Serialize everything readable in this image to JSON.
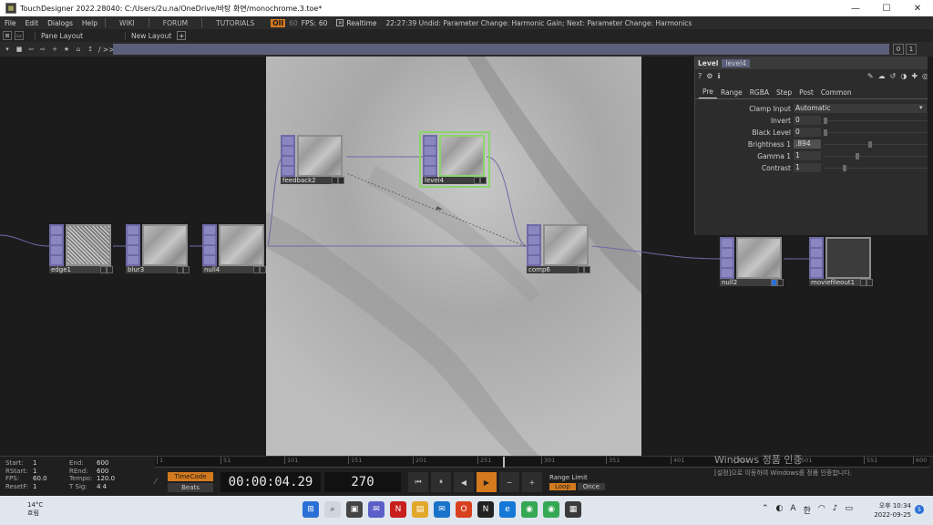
{
  "window": {
    "title": "TouchDesigner 2022.28040: C:/Users/2u.na/OneDrive/바탕 화면/monochrome.3.toe*",
    "minimize": "—",
    "maximize": "☐",
    "close": "✕"
  },
  "menubar": {
    "items": [
      "File",
      "Edit",
      "Dialogs",
      "Help"
    ],
    "wiki": "WIKI",
    "forum": "FORUM",
    "tutorials": "TUTORIALS",
    "perf": "OII",
    "fps_small": "60",
    "fps_label": "FPS:",
    "fps_value": "60",
    "realtime": "Realtime",
    "status": "22:27:39 Undid: Parameter Change: Harmonic Gain; Next: Parameter Change: Harmonics"
  },
  "panebar": {
    "pane_layout": "Pane Layout",
    "new_layout": "New Layout",
    "plus": "+"
  },
  "nettool": {
    "path_label": "/ >>",
    "num_left": "0",
    "num_right": "1"
  },
  "nodes": {
    "edge1": "edge1",
    "blur3": "blur3",
    "null4": "null4",
    "feedback2": "feedback2",
    "level4": "level4",
    "comp6": "comp6",
    "null2": "null2",
    "moviefileout1": "moviefileout1"
  },
  "params": {
    "type": "Level",
    "name": "level4",
    "tabs": [
      "Pre",
      "Range",
      "RGBA",
      "Step",
      "Post",
      "Common"
    ],
    "rows": [
      {
        "label": "Clamp Input",
        "value": "Automatic"
      },
      {
        "label": "Invert",
        "value": "0"
      },
      {
        "label": "Black Level",
        "value": "0"
      },
      {
        "label": "Brightness 1",
        "value": ".894"
      },
      {
        "label": "Gamma 1",
        "value": "1"
      },
      {
        "label": "Contrast",
        "value": "1"
      }
    ]
  },
  "timeline": {
    "info": [
      {
        "k": "Start:",
        "v": "1",
        "k2": "End:",
        "v2": "600"
      },
      {
        "k": "RStart:",
        "v": "1",
        "k2": "REnd:",
        "v2": "600"
      },
      {
        "k": "FPS:",
        "v": "60.0",
        "k2": "Tempo:",
        "v2": "120.0"
      },
      {
        "k": "ResetF:",
        "v": "1",
        "k2": "T Sig:",
        "v2": "4    4"
      }
    ],
    "ticks": [
      "1",
      "51",
      "101",
      "151",
      "201",
      "251",
      "301",
      "351",
      "401",
      "451",
      "501",
      "551",
      "600"
    ],
    "timecode_label": "TimeCode",
    "beats_label": "Beats",
    "time": "00:00:04.29",
    "frame": "270",
    "range_limit": "Range Limit",
    "loop": "Loop",
    "once": "Once"
  },
  "watermark": {
    "line1": "Windows 정품 인증",
    "line2": "[설정]으로 이동하여 Windows를 정품 인증합니다."
  },
  "taskbar": {
    "temp": "14°C",
    "weather": "흐림",
    "lang": "A",
    "ime": "한",
    "time": "오후 10:34",
    "date": "2022-09-25",
    "notif": "5"
  }
}
